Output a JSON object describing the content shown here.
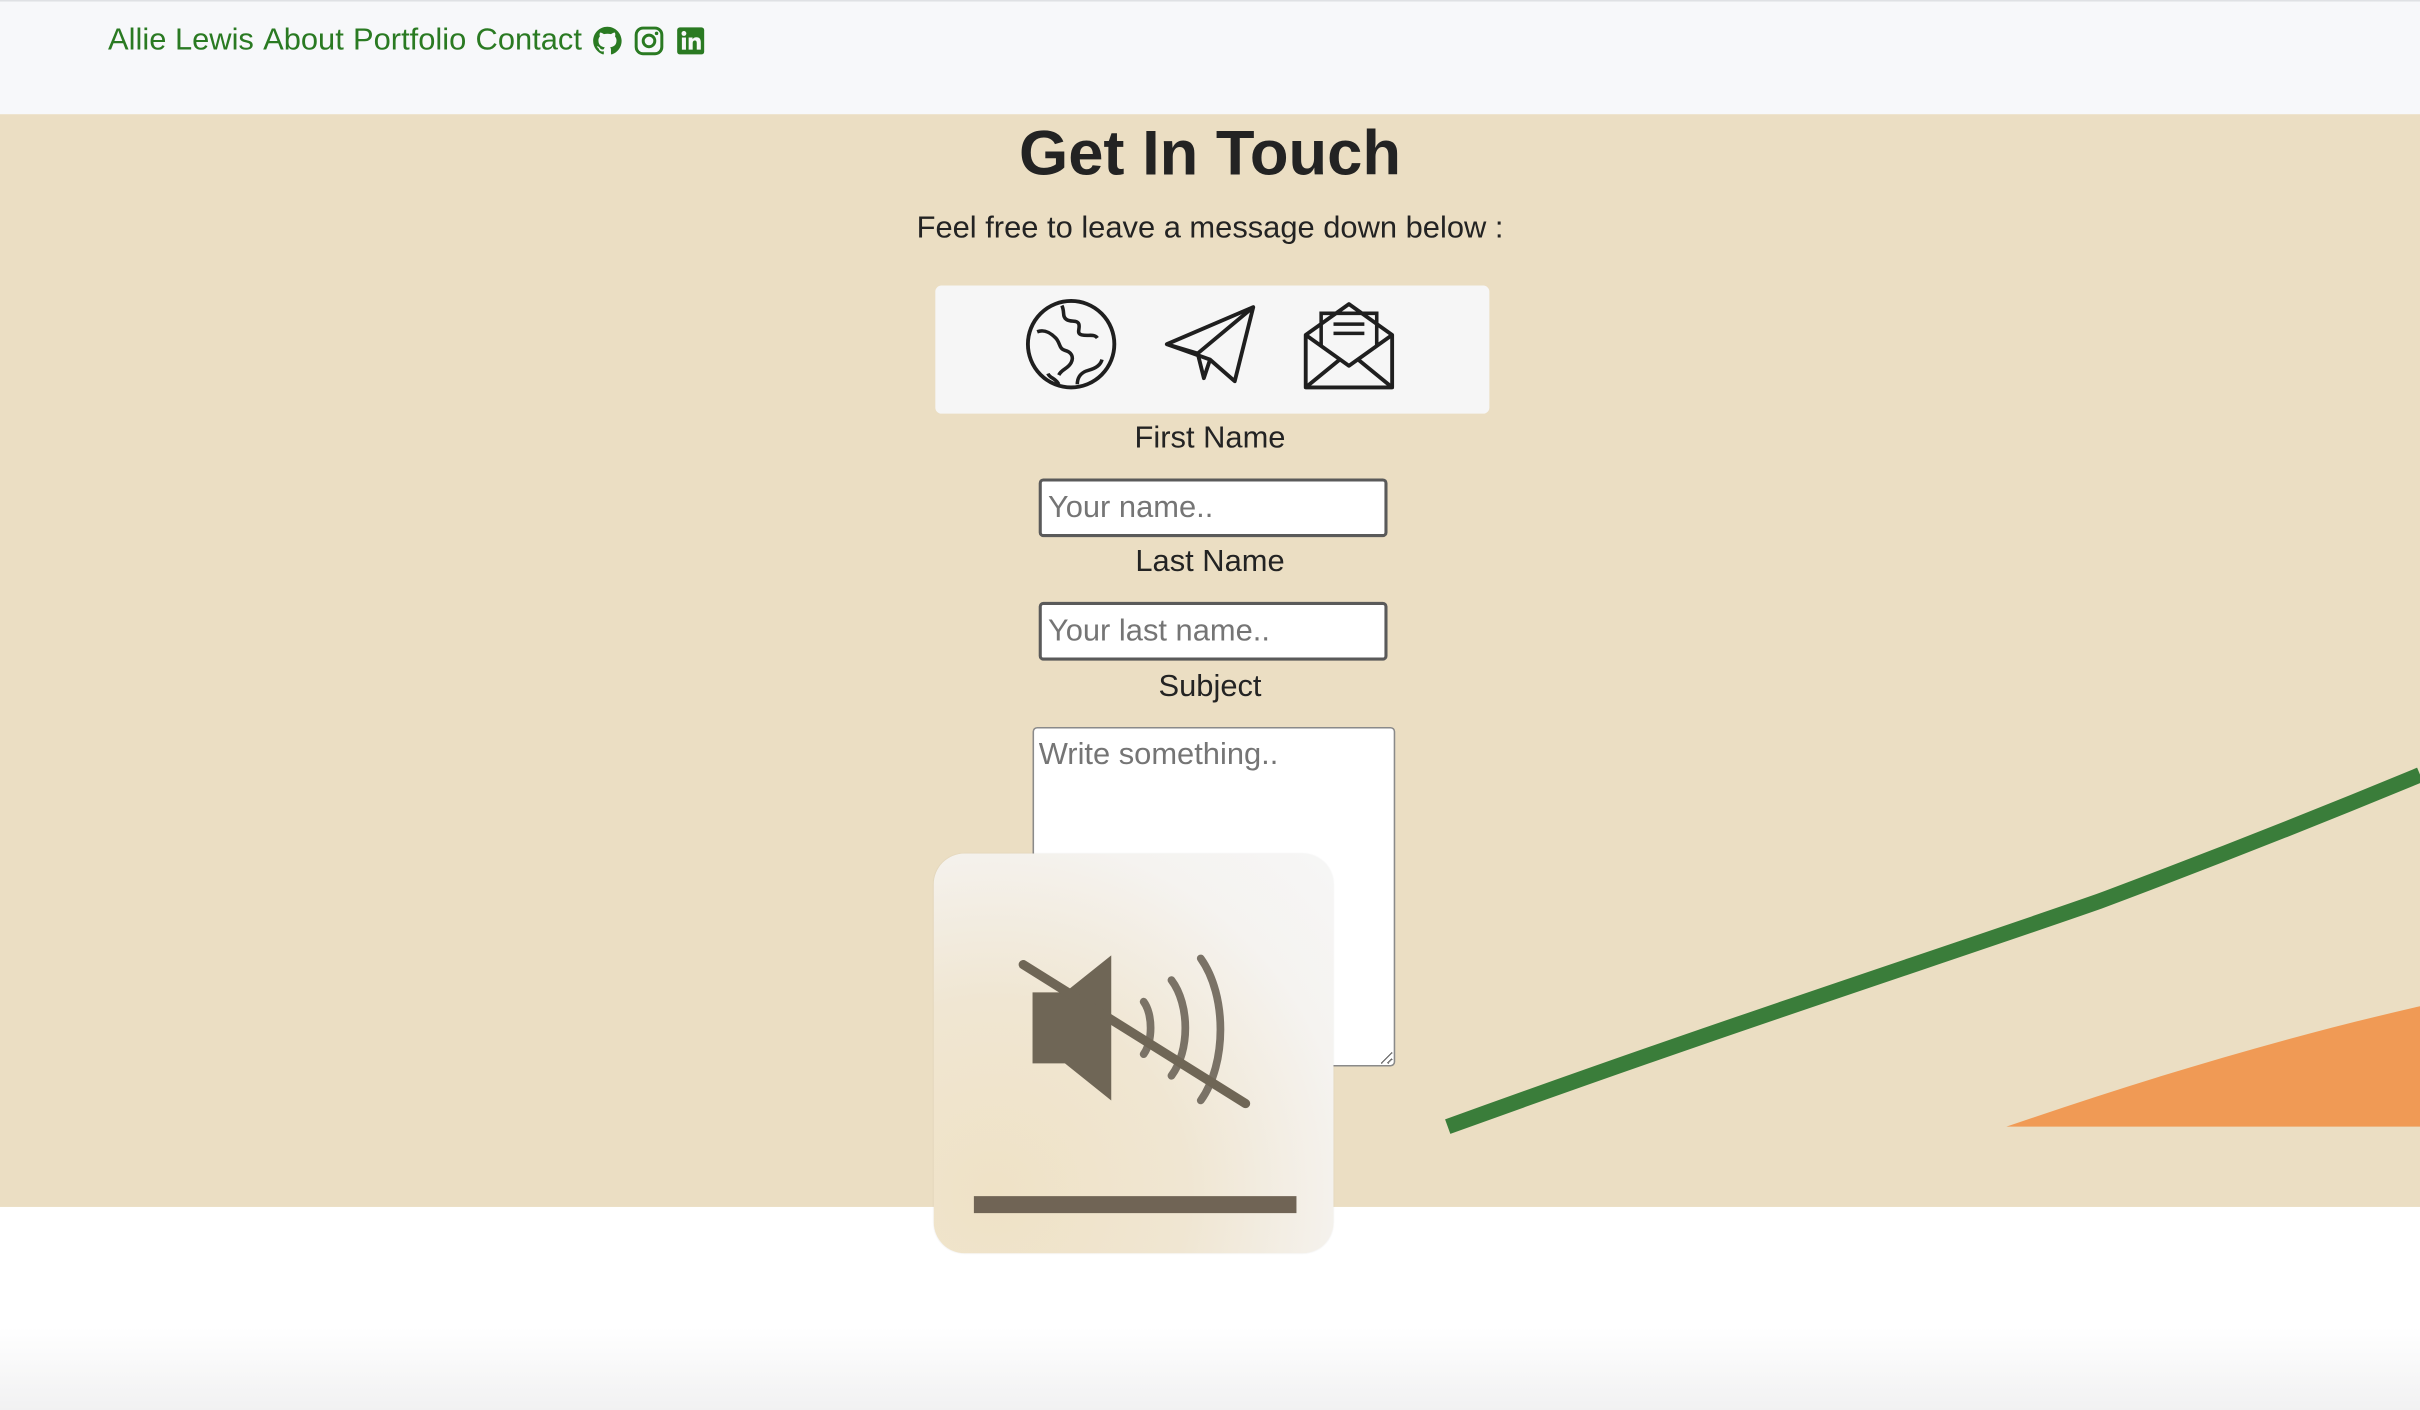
{
  "nav": {
    "brand": "Allie Lewis",
    "links": [
      "About",
      "Portfolio",
      "Contact"
    ],
    "social_icons": [
      "github-icon",
      "instagram-icon",
      "linkedin-icon"
    ],
    "link_color": "#2a7a22"
  },
  "contact": {
    "title": "Get In Touch",
    "subtitle": "Feel free to leave a message down below :",
    "icons": [
      "globe-icon",
      "paper-plane-icon",
      "open-envelope-icon"
    ],
    "first_name_label": "First Name",
    "first_name_placeholder": "Your name..",
    "first_name_value": "",
    "last_name_label": "Last Name",
    "last_name_placeholder": "Your last name..",
    "last_name_value": "",
    "subject_label": "Subject",
    "subject_placeholder": "Write something..",
    "subject_value": "",
    "submit_fragment": ")",
    "background_color": "#ebdec3",
    "accent_green": "#3a7d3a",
    "accent_orange": "#f09a55"
  },
  "mute_hud": {
    "icon": "speaker-muted-icon",
    "volume_level": 1.0
  }
}
